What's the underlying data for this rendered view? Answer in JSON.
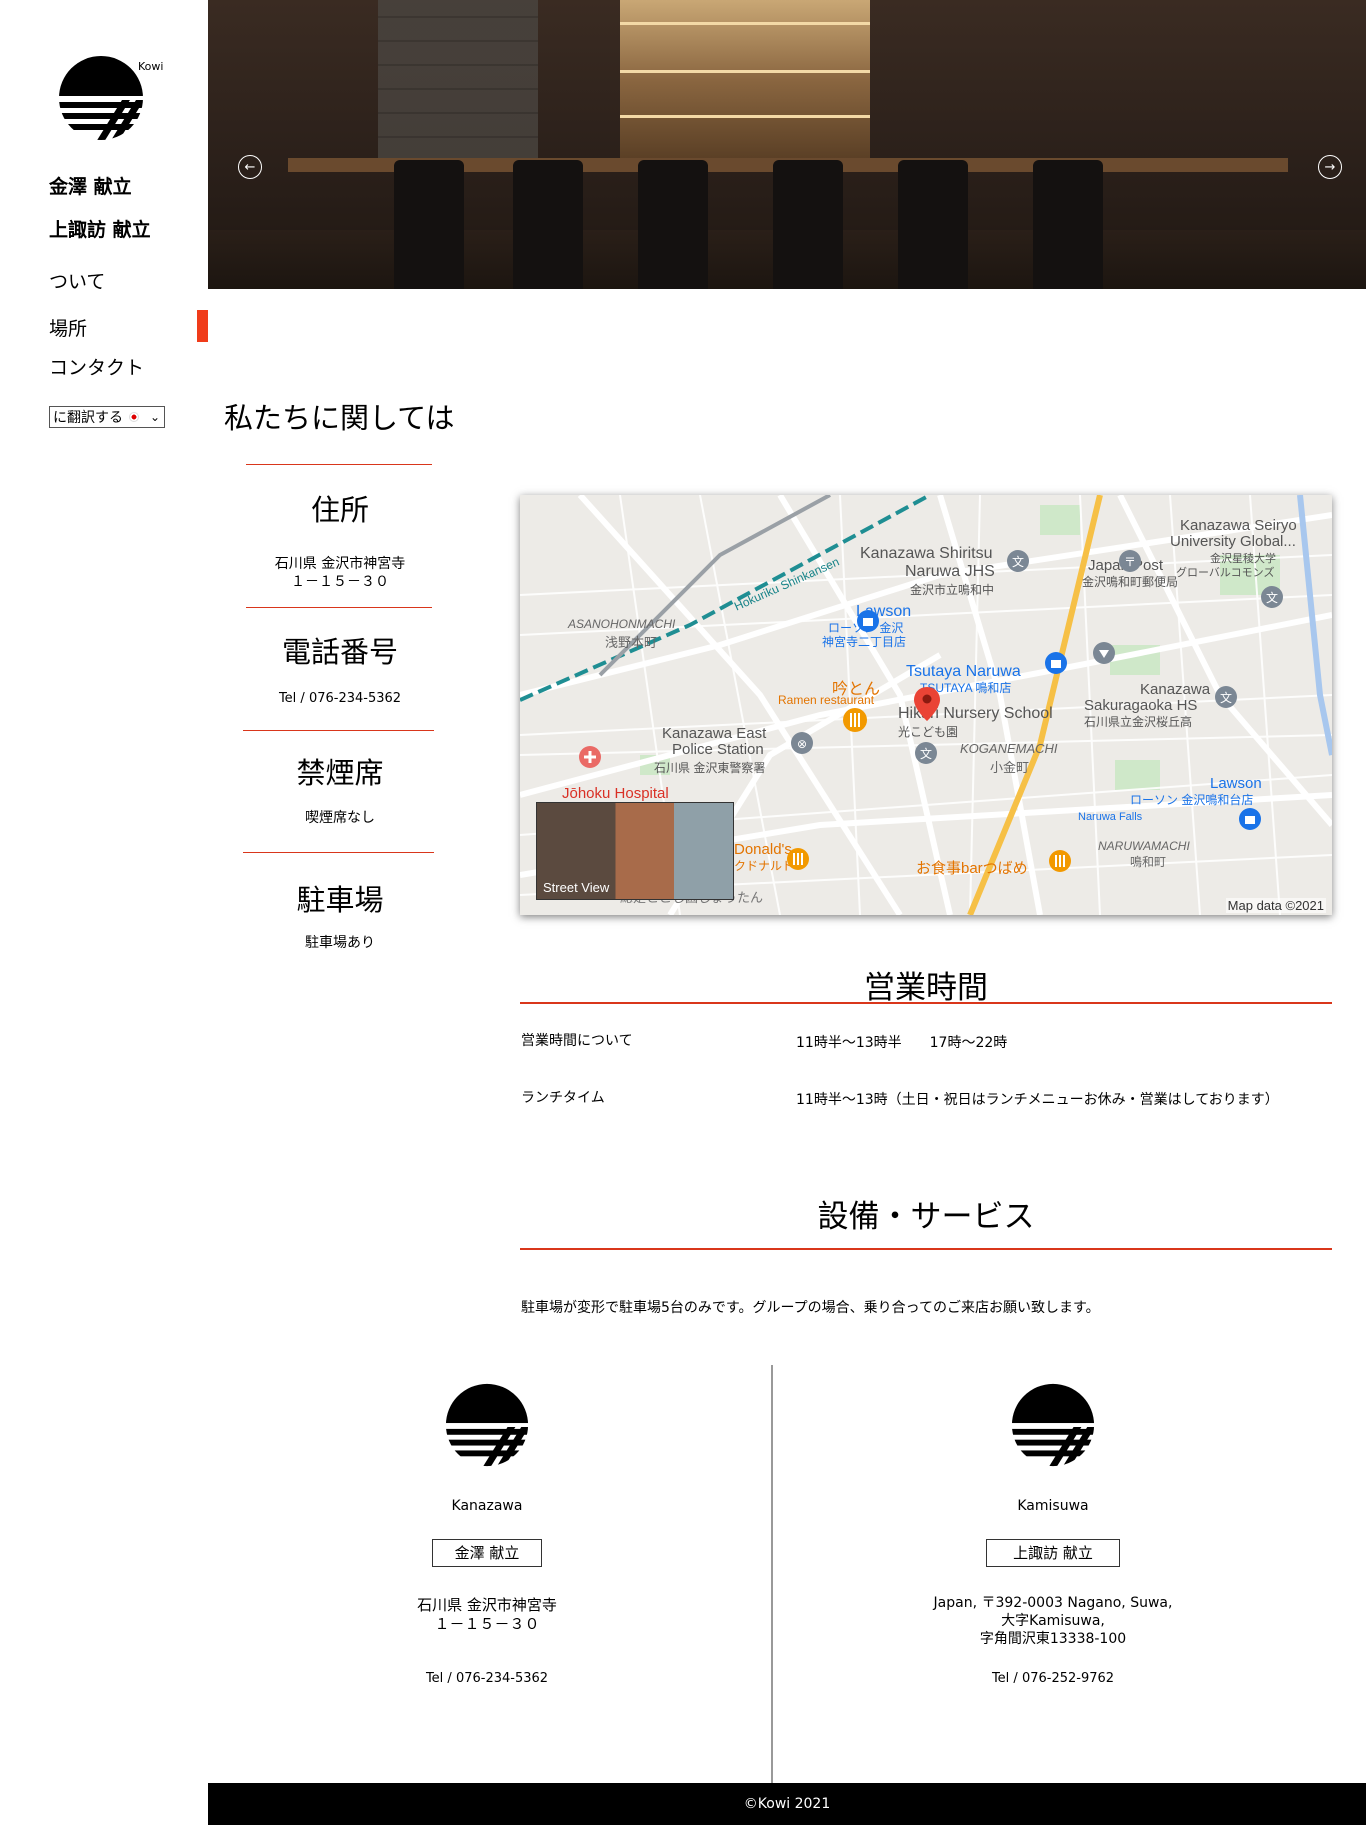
{
  "brand": {
    "logo_text": "Kowi"
  },
  "nav": {
    "items": [
      {
        "label": "金澤 献立"
      },
      {
        "label": "上諏訪 献立"
      },
      {
        "label": "ついて"
      },
      {
        "label": "場所"
      },
      {
        "label": "コンタクト"
      }
    ],
    "active_index": 3,
    "accent_color": "#f03c1a"
  },
  "translate": {
    "label": "に翻訳する"
  },
  "hero": {
    "prev_icon": "arrow-left-icon",
    "next_icon": "arrow-right-icon"
  },
  "about": {
    "title": "私たちに関しては",
    "items": [
      {
        "heading": "住所",
        "lines": [
          "石川県 金沢市神宮寺",
          "１－１５－３０"
        ]
      },
      {
        "heading": "電話番号",
        "lines": [
          "Tel / 076-234-5362"
        ]
      },
      {
        "heading": "禁煙席",
        "lines": [
          "喫煙席なし"
        ]
      },
      {
        "heading": "駐車場",
        "lines": [
          "駐車場あり"
        ]
      }
    ]
  },
  "map": {
    "labels": {
      "school": "Kanazawa Shiritsu",
      "school2": "Naruwa JHS",
      "school3": "金沢市立鳴和中",
      "lawson1": "Lawson",
      "lawson1_jp": "ローソン 金沢",
      "lawson1_jp2": "神宮寺二丁目店",
      "shinkansen": "Hokuriku Shinkansen",
      "asanohon": "ASANOHONMACHI",
      "asanohon_jp": "浅野本町",
      "ramen": "吟とん",
      "ramen_sub": "Ramen restaurant",
      "tsutaya": "Tsutaya Naruwa",
      "tsutaya_jp": "TSUTAYA 鳴和店",
      "nursery": "Hikari Nursery School",
      "nursery_jp": "光こども園",
      "police": "Kanazawa East",
      "police2": "Police Station",
      "police_jp": "石川県 金沢東警察署",
      "koganemachi": "KOGANEMACHI",
      "koganemachi_jp": "小金町",
      "hospital": "Jōhoku Hospital",
      "japanpost": "Japan Post",
      "japanpost_jp": "金沢鳴和町郵便局",
      "seiryo": "Kanazawa Seiryo",
      "seiryo2": "University Global...",
      "seiryo_jp": "金沢星稜大学",
      "seiryo_jp2": "グローバルコモンズ",
      "sakuragaoka": "Kanazawa",
      "sakuragaoka2": "Sakuragaoka HS",
      "sakuragaoka_jp": "石川県立金沢桜丘高",
      "lawson2": "Lawson",
      "lawson2_jp": "ローソン 金沢鳴和台店",
      "naruwafalls": "Naruwa Falls",
      "naruwamachi": "NARUWAMACHI",
      "naruwamachi_jp": "鳴和町",
      "mcd": "Donald's",
      "mcd_jp": "クドナルド",
      "tsubame": "お食事barつばめ",
      "bottom": "総是とこし園じょうたん"
    },
    "streetview_label": "Street View",
    "credit": "Map data ©2021"
  },
  "hours": {
    "title": "営業時間",
    "rows": [
      {
        "label": "営業時間について",
        "value": "11時半～13時半　　17時～22時"
      },
      {
        "label": "ランチタイム",
        "value": "11時半～13時（土日・祝日はランチメニューお休み・営業はしております）"
      }
    ]
  },
  "facilities": {
    "title": "設備・サービス",
    "text": "駐車場が変形で駐車場5台のみです。グループの場合、乗り合ってのご来店お願い致します。"
  },
  "locations": [
    {
      "name": "Kanazawa",
      "button": "金澤 献立",
      "address": [
        "石川県 金沢市神宮寺",
        "１－１５－３０"
      ],
      "tel": "Tel / 076-234-5362"
    },
    {
      "name": "Kamisuwa",
      "button": "上諏訪 献立",
      "address": [
        "Japan, 〒392-0003 Nagano, Suwa,",
        "大字Kamisuwa,",
        "字角間沢東13338-100"
      ],
      "tel": "Tel / 076-252-9762"
    }
  ],
  "footer": {
    "copyright": "©Kowi 2021"
  }
}
